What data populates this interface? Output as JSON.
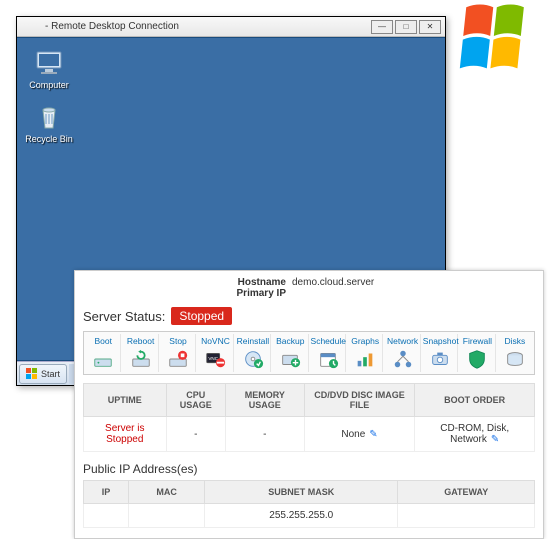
{
  "rdp": {
    "title": " - Remote Desktop Connection",
    "icons": {
      "computer": "Computer",
      "recycle": "Recycle Bin"
    },
    "start": "Start"
  },
  "server": {
    "hostname_label": "Hostname",
    "hostname": "demo.cloud.server",
    "primary_ip_label": "Primary IP",
    "primary_ip": "",
    "status_label": "Server Status:",
    "status_value": "Stopped",
    "actions": {
      "boot": "Boot",
      "reboot": "Reboot",
      "stop": "Stop",
      "novnc": "NoVNC",
      "reinstall": "Reinstall",
      "backup": "Backup",
      "schedule": "Schedule",
      "graphs": "Graphs",
      "network": "Network",
      "snapshot": "Snapshot",
      "firewall": "Firewall",
      "disks": "Disks"
    },
    "status_table": {
      "headers": {
        "uptime": "UPTIME",
        "cpu": "CPU USAGE",
        "memory": "MEMORY USAGE",
        "cd": "CD/DVD DISC IMAGE FILE",
        "boot_order": "BOOT ORDER"
      },
      "row": {
        "uptime": "Server is Stopped",
        "cpu": "-",
        "memory": "-",
        "cd": "None",
        "boot_order": "CD-ROM, Disk, Network"
      }
    },
    "ip_section_title": "Public IP Address(es)",
    "ip_table": {
      "headers": {
        "ip": "IP",
        "mac": "MAC",
        "subnet": "SUBNET MASK",
        "gateway": "GATEWAY"
      },
      "row": {
        "ip": "",
        "mac": "",
        "subnet": "255.255.255.0",
        "gateway": ""
      }
    }
  }
}
